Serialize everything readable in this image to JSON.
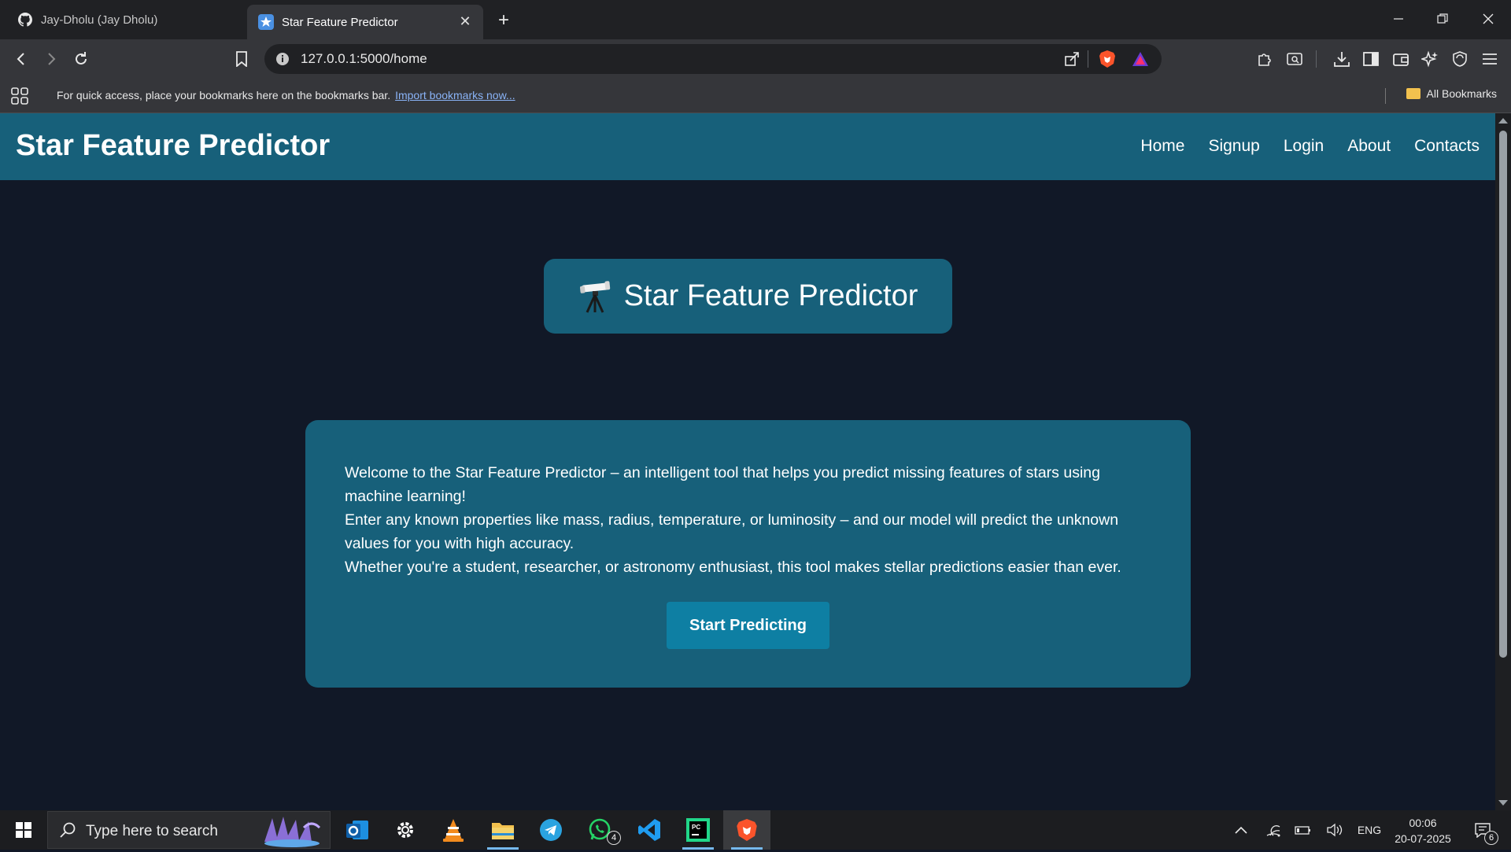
{
  "browser": {
    "tabs": [
      {
        "title": "Jay-Dholu (Jay Dholu)",
        "icon": "github-icon",
        "active": false
      },
      {
        "title": "Star Feature Predictor",
        "icon": "star-icon",
        "active": true
      }
    ],
    "url": "127.0.0.1:5000/home",
    "bookmarks_bar": {
      "message": "For quick access, place your bookmarks here on the bookmarks bar.",
      "link": "Import bookmarks now...",
      "all_bookmarks": "All Bookmarks"
    }
  },
  "site": {
    "brand": "Star Feature Predictor",
    "nav": [
      "Home",
      "Signup",
      "Login",
      "About",
      "Contacts"
    ],
    "hero_title": "Star Feature Predictor",
    "intro": [
      "Welcome to the Star Feature Predictor – an intelligent tool that helps you predict missing features of stars using machine learning!",
      "Enter any known properties like mass, radius, temperature, or luminosity – and our model will predict the unknown values for you with high accuracy.",
      "Whether you're a student, researcher, or astronomy enthusiast, this tool makes stellar predictions easier than ever."
    ],
    "cta": "Start Predicting",
    "colors": {
      "header": "#17607a",
      "background": "#111827",
      "button": "#0e7fa3"
    }
  },
  "taskbar": {
    "search_placeholder": "Type here to search",
    "whatsapp_badge": "4",
    "language": "ENG",
    "time": "00:06",
    "date": "20-07-2025",
    "notifications_badge": "6"
  }
}
